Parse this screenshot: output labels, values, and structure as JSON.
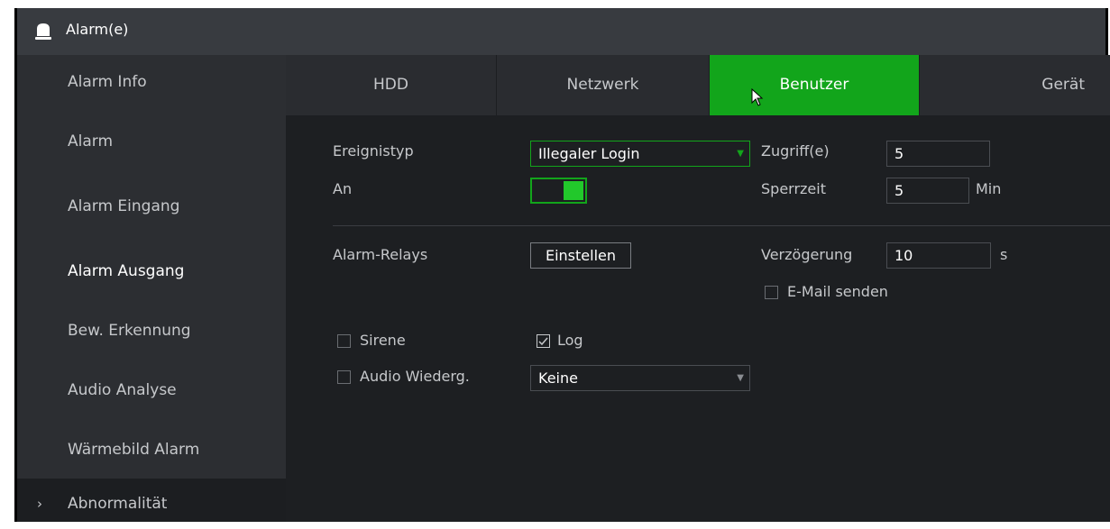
{
  "window": {
    "title": "Alarm(e)",
    "icon": "alarm-bell-icon"
  },
  "sidebar": {
    "items": [
      {
        "label": "Alarm Info"
      },
      {
        "label": "Alarm"
      },
      {
        "label": "Alarm Eingang"
      },
      {
        "label": "Alarm Ausgang"
      },
      {
        "label": "Bew. Erkennung"
      },
      {
        "label": "Audio Analyse"
      },
      {
        "label": "Wärmebild Alarm"
      },
      {
        "label": "Abnormalität",
        "chevron": "›"
      }
    ]
  },
  "tabs": [
    {
      "label": "HDD"
    },
    {
      "label": "Netzwerk"
    },
    {
      "label": "Benutzer"
    },
    {
      "label": "Gerät"
    }
  ],
  "form": {
    "event_type_label": "Ereignistyp",
    "event_type_value": "Illegaler Login",
    "enable_label": "An",
    "access_label": "Zugriff(e)",
    "access_value": "5",
    "lock_label": "Sperrzeit",
    "lock_value": "5",
    "lock_unit": "Min",
    "relay_label": "Alarm-Relays",
    "relay_button": "Einstellen",
    "delay_label": "Verzögerung",
    "delay_value": "10",
    "delay_unit": "s",
    "email_label": "E-Mail senden",
    "siren_label": "Sirene",
    "log_label": "Log",
    "audio_label": "Audio Wiederg.",
    "audio_value": "Keine"
  },
  "colors": {
    "accent": "#12a51b",
    "background": "#1d1f22",
    "sidebar": "#2c2e32"
  }
}
